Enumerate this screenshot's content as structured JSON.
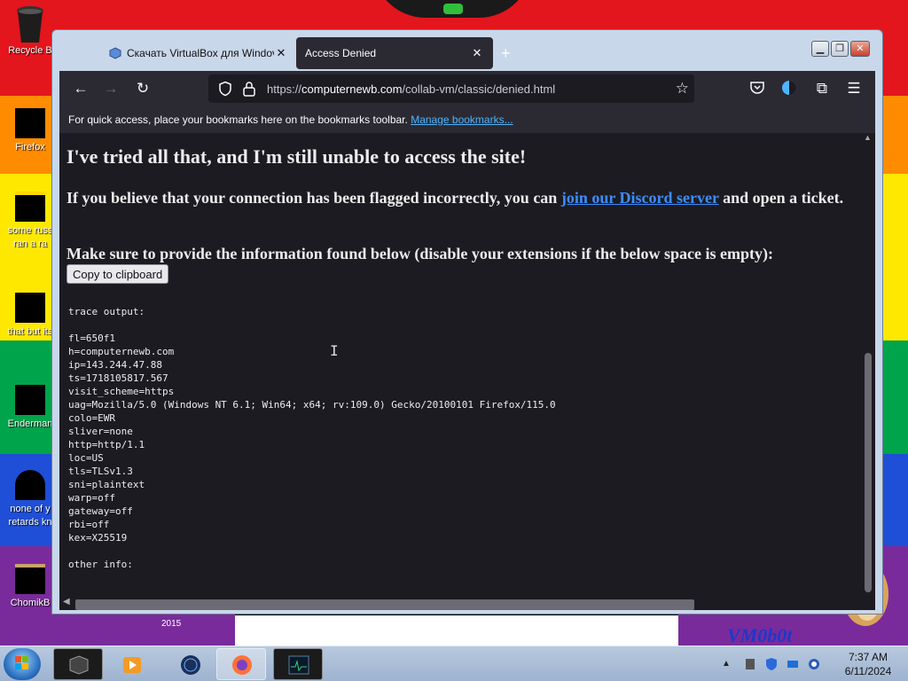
{
  "desktop": {
    "icons": [
      {
        "label": "Recycle B",
        "label2": ""
      },
      {
        "label": "Firefox",
        "label2": ""
      },
      {
        "label": "some russ",
        "label2": "ran a ra"
      },
      {
        "label": "that but its",
        "label2": ""
      },
      {
        "label": "Enderman",
        "label2": ""
      },
      {
        "label": "none of y",
        "label2": "retards kn"
      },
      {
        "label": "ChomikB",
        "label2": ""
      }
    ],
    "wallpaper_year": "2015",
    "wallpaper_signature": "VM0b0t",
    "colors": {
      "red": "#e3151d",
      "orange": "#ff8c00",
      "yellow": "#ffe800",
      "green": "#00a44a",
      "blue": "#1e4fd6",
      "purple": "#7a2b9b"
    }
  },
  "browser": {
    "tabs": [
      {
        "title": "Скачать VirtualBox для Windov",
        "close": "✕",
        "favicon": "virtualbox-icon"
      },
      {
        "title": "Access Denied",
        "close": "✕"
      }
    ],
    "new_tab": "+",
    "url_prefix": "https://",
    "url_host": "computernewb.com",
    "url_path": "/collab-vm/classic/denied.html",
    "bookmarks_text": "For quick access, place your bookmarks here on the bookmarks toolbar.",
    "bookmarks_link": "Manage bookmarks...",
    "colors": {
      "chrome": "#2b2a33",
      "page": "#1c1b22",
      "link": "#3d8dff"
    }
  },
  "page": {
    "heading": "I've tried all that, and I'm still unable to access the site!",
    "p1_before": "If you believe that your connection has been flagged incorrectly, you can ",
    "p1_link": "join our Discord server",
    "p1_after": " and open a ticket.",
    "p2": "Make sure to provide the information found below (disable your extensions if the below space is empty):",
    "copy_button": "Copy to clipboard",
    "trace": "trace output:\n\nfl=650f1\nh=computernewb.com\nip=143.244.47.88\nts=1718105817.567\nvisit_scheme=https\nuag=Mozilla/5.0 (Windows NT 6.1; Win64; x64; rv:109.0) Gecko/20100101 Firefox/115.0\ncolo=EWR\nsliver=none\nhttp=http/1.1\nloc=US\ntls=TLSv1.3\nsni=plaintext\nwarp=off\ngateway=off\nrbi=off\nkex=X25519\n\nother info:"
  },
  "taskbar": {
    "time": "7:37 AM",
    "date": "6/11/2024"
  }
}
